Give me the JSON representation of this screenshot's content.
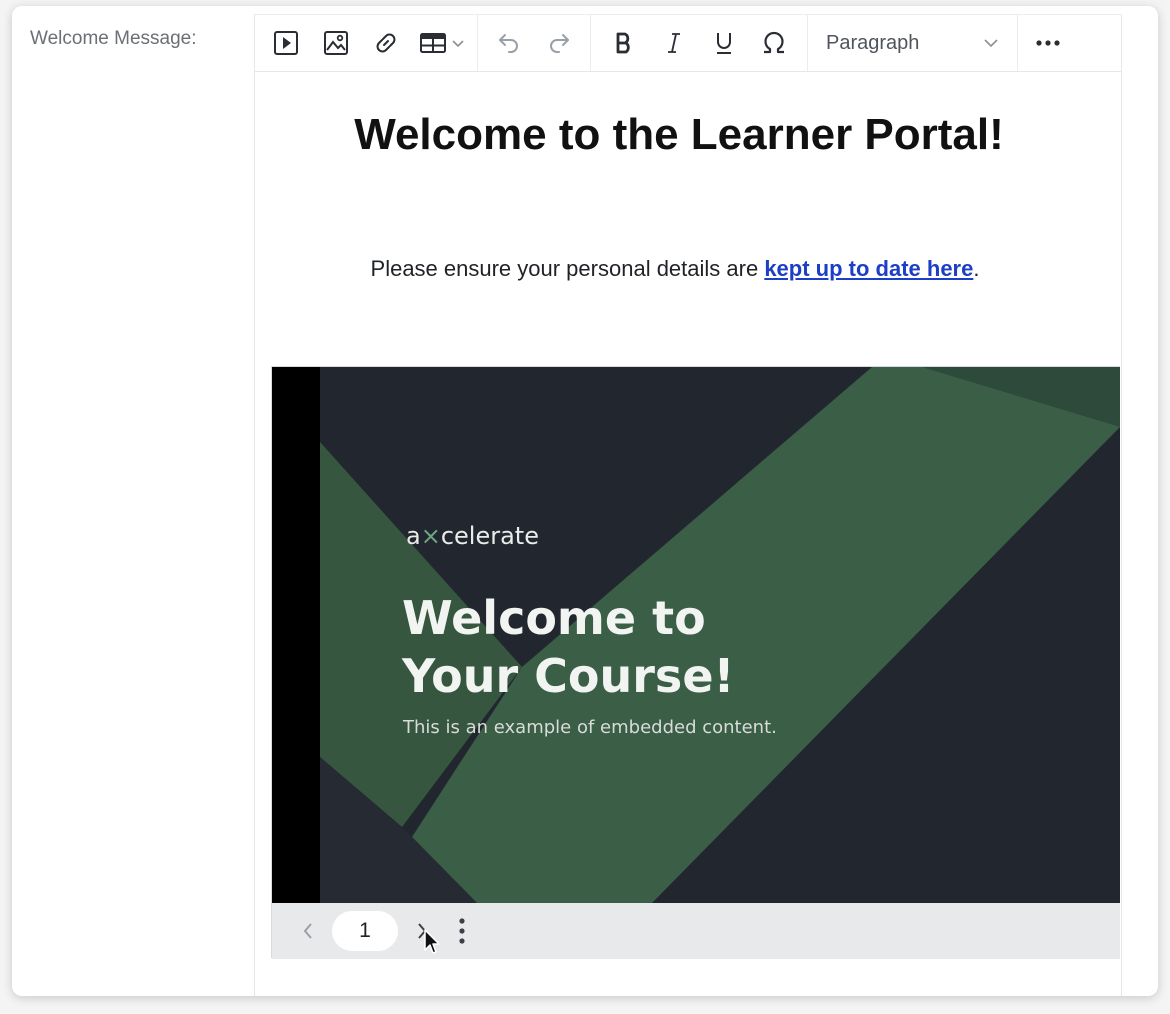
{
  "field": {
    "label": "Welcome Message:"
  },
  "toolbar": {
    "format_value": "Paragraph",
    "icons": [
      "media-icon",
      "image-icon",
      "link-icon",
      "table-icon",
      "undo-icon",
      "redo-icon",
      "bold-icon",
      "italic-icon",
      "underline-icon",
      "special-char-icon",
      "more-icon"
    ]
  },
  "content": {
    "title": "Welcome to the Learner Portal!",
    "para_before": "Please ensure your personal details are ",
    "link_text": "kept up to date here",
    "para_after": "."
  },
  "embed": {
    "logo_a": "a",
    "logo_rest": "celerate",
    "slide_title_1": "Welcome to",
    "slide_title_2": "Your Course!",
    "slide_subtitle": "This is an example of embedded content.",
    "page_number": "1"
  },
  "colors": {
    "link": "#1d3fc7",
    "slide_bg": "#22262f",
    "slide_green": "#3a5e46",
    "slide_green_dark": "#2f4b3b"
  }
}
